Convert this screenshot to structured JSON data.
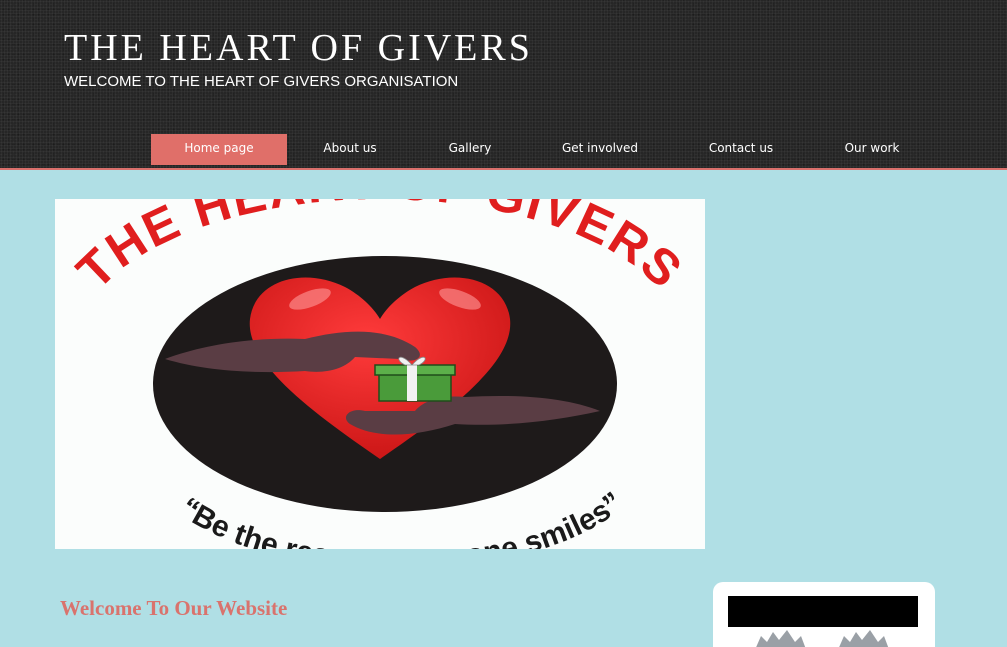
{
  "header": {
    "title": "THE HEART OF GIVERS",
    "subtitle": "WELCOME TO THE HEART OF GIVERS ORGANISATION"
  },
  "nav": {
    "items": [
      {
        "label": "Home page",
        "active": true
      },
      {
        "label": "About us",
        "active": false
      },
      {
        "label": "Gallery",
        "active": false
      },
      {
        "label": "Get involved",
        "active": false
      },
      {
        "label": "Contact us",
        "active": false
      },
      {
        "label": "Our work",
        "active": false
      }
    ]
  },
  "logo": {
    "arc_text": "THE HEART OF GIVERS",
    "slogan": "“Be the reason someone smiles”"
  },
  "main": {
    "welcome_heading": "Welcome To Our Website"
  },
  "colors": {
    "accent": "#e06f69",
    "header_bg": "#262626",
    "page_bg": "#b0dfe5",
    "heading": "#d9736d"
  }
}
